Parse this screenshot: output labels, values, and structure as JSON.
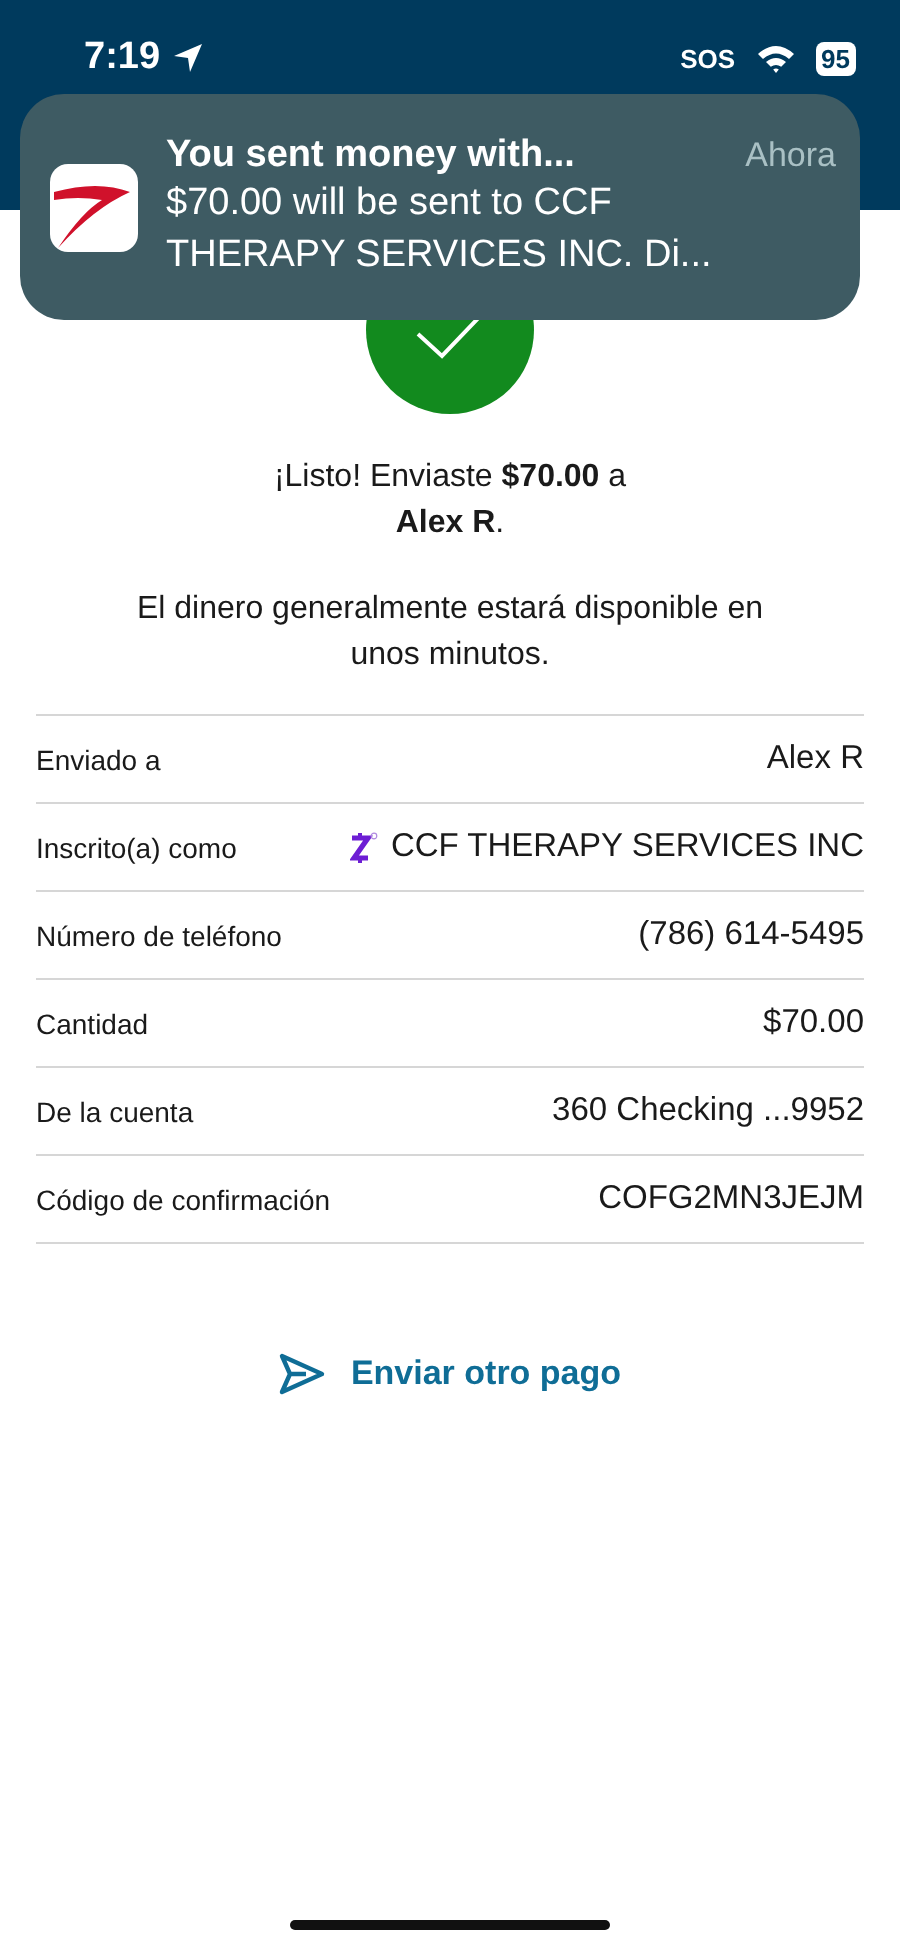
{
  "status_bar": {
    "time": "7:19",
    "sos": "SOS",
    "battery": "95"
  },
  "notification": {
    "title": "You sent money with...",
    "time": "Ahora",
    "body": "$70.00 will be sent to CCF THERAPY SERVICES INC. Di..."
  },
  "success": {
    "message": "¡Listo! Enviaste **$70.00** a **Alex R**.",
    "note": "El dinero generalmente estará disponible en unos minutos."
  },
  "details": [
    {
      "kind": "plain",
      "label": "Enviado a",
      "value": "Alex R"
    },
    {
      "kind": "enrolled",
      "label": "Inscrito(a) como",
      "value": "CCF THERAPY SERVICES INC"
    },
    {
      "kind": "plain",
      "label": "Número de teléfono",
      "value": "(786) 614-5495"
    },
    {
      "kind": "plain",
      "label": "Cantidad",
      "value": "$70.00"
    },
    {
      "kind": "plain",
      "label": "De la cuenta",
      "value": "360 Checking ...9952"
    },
    {
      "kind": "plain",
      "label": "Código de confirmación",
      "value": "COFG2MN3JEJM"
    }
  ],
  "action": {
    "label": "Enviar otro pago"
  }
}
